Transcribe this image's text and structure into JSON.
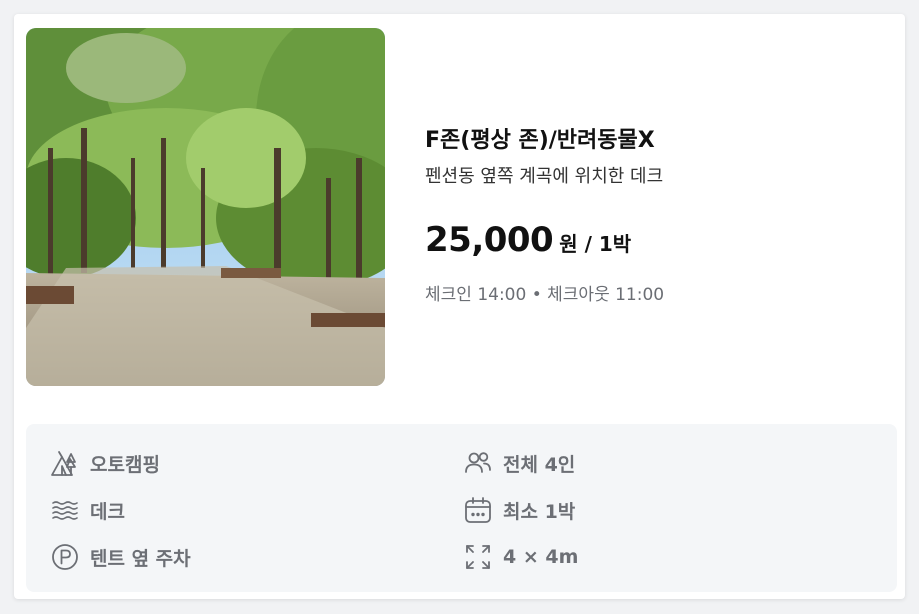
{
  "listing": {
    "title": "F존(평상 존)/반려동물X",
    "subtitle": "펜션동 옆쪽 계곡에 위치한 데크",
    "price": "25,000",
    "price_unit": "원 / 1박",
    "checkin_text": "체크인 14:00 • 체크아웃 11:00",
    "photo_icon": "campsite-forest-photo"
  },
  "features": {
    "left": [
      {
        "icon": "tent-icon",
        "label": "오토캠핑"
      },
      {
        "icon": "waves-icon",
        "label": "데크"
      },
      {
        "icon": "parking-icon",
        "label": "텐트 옆 주차"
      }
    ],
    "right": [
      {
        "icon": "people-icon",
        "label": "전체 4인"
      },
      {
        "icon": "calendar-icon",
        "label": "최소 1박"
      },
      {
        "icon": "expand-icon",
        "label": "4 × 4m"
      }
    ]
  },
  "colors": {
    "title": "#111111",
    "muted": "#6b6e74",
    "feature_bg": "#f4f6f8",
    "icon": "#6c6f75"
  }
}
